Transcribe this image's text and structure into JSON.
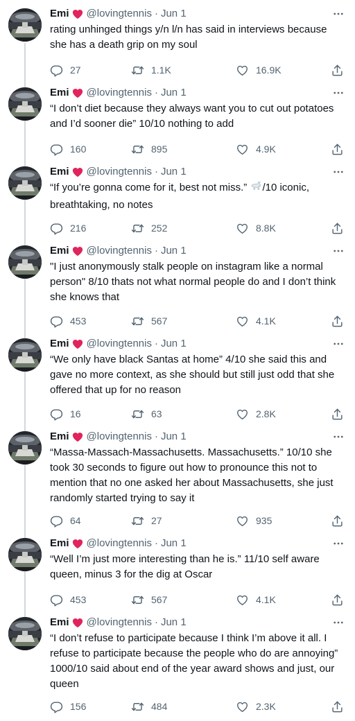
{
  "user": {
    "name": "Emi",
    "handle": "@lovingtennis",
    "date": "Jun 1"
  },
  "colors": {
    "heart": "#e0245e",
    "muted": "#536471",
    "thread_line": "#cfd9de"
  },
  "icons": {
    "reply": "reply-icon",
    "retweet": "retweet-icon",
    "like": "like-icon",
    "share": "share-icon",
    "more": "more-icon",
    "heart": "red-heart-emoji-icon",
    "goat": "goat-emoji-icon"
  },
  "tweets": [
    {
      "text": "rating unhinged things y/n l/n has said in interviews because she has a death grip on my soul",
      "replies": "27",
      "retweets": "1.1K",
      "likes": "16.9K"
    },
    {
      "text": "“I don’t diet because they always want you to cut out potatoes and I’d sooner die” 10/10 nothing to add",
      "replies": "160",
      "retweets": "895",
      "likes": "4.9K"
    },
    {
      "text_before": "“If you’re gonna come for it, best not miss.” ",
      "text_after": "/10 iconic, breathtaking, no notes",
      "replies": "216",
      "retweets": "252",
      "likes": "8.8K"
    },
    {
      "text": "\"I just anonymously stalk people on instagram like a normal person\" 8/10 thats not what normal people do and I don’t think she knows that",
      "replies": "453",
      "retweets": "567",
      "likes": "4.1K"
    },
    {
      "text": "“We only have black Santas at home” 4/10 she said this and gave no more context, as she should but still just odd that she offered that up for no reason",
      "replies": "16",
      "retweets": "63",
      "likes": "2.8K"
    },
    {
      "text": "“Massa-Massach-Massachusetts. Massachusetts.” 10/10 she took 30 seconds to figure out how to pronounce this not to mention that no one asked her about Massachusetts, she just randomly started trying to say it",
      "replies": "64",
      "retweets": "27",
      "likes": "935"
    },
    {
      "text": "“Well I’m just more interesting than he is.” 11/10 self aware queen, minus 3 for the dig at Oscar",
      "replies": "453",
      "retweets": "567",
      "likes": "4.1K"
    },
    {
      "text": "“I don’t refuse to participate because I think I’m above it all. I refuse to participate because the people who do are annoying” 1000/10 said about end of the year award shows and just, our queen",
      "replies": "156",
      "retweets": "484",
      "likes": "2.3K"
    }
  ]
}
